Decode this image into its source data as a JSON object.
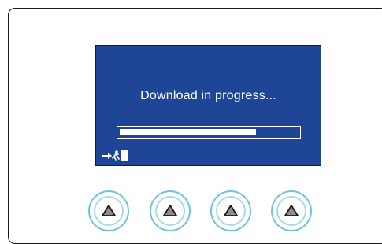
{
  "screen": {
    "message": "Download in progress...",
    "progress_fraction": 0.77,
    "background_color": "#1f4596",
    "exit_icon": "exit-door-icon"
  },
  "buttons": [
    {
      "icon": "triangle-up-icon"
    },
    {
      "icon": "triangle-up-icon"
    },
    {
      "icon": "triangle-up-icon"
    },
    {
      "icon": "triangle-up-icon"
    }
  ],
  "colors": {
    "button_ring": "#6fc4dc",
    "button_symbol": "#8c8c8c"
  }
}
